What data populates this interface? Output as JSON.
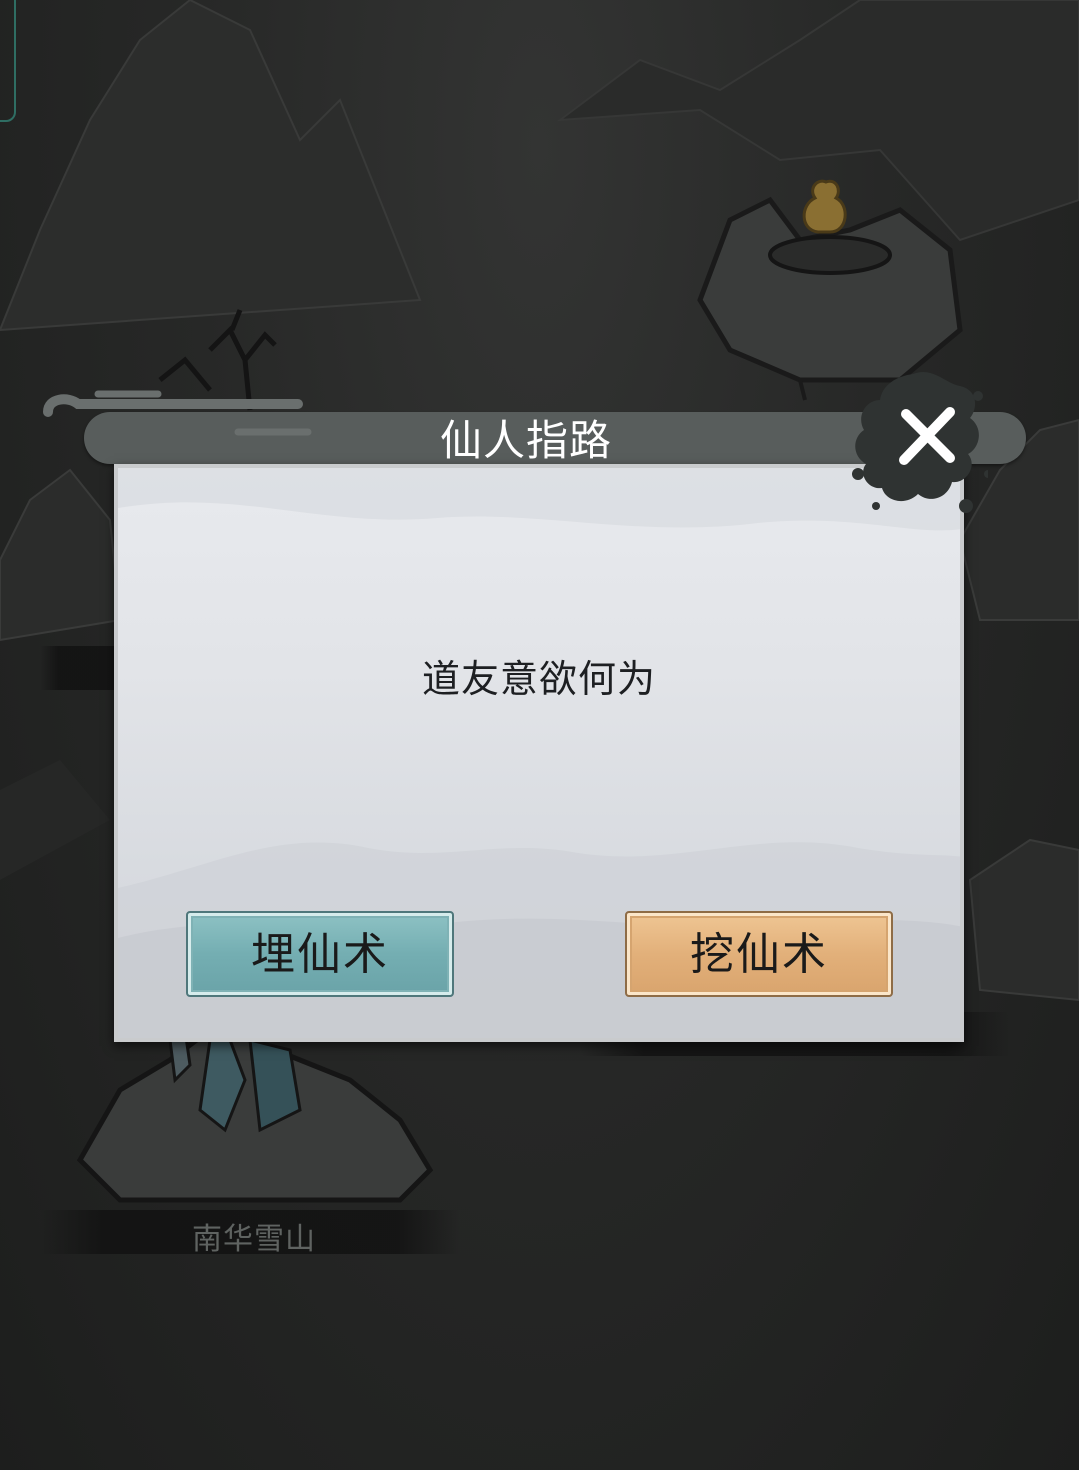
{
  "map": {
    "locations": [
      {
        "id": "nanhua",
        "label": "南华雪山"
      }
    ]
  },
  "dialog": {
    "title": "仙人指路",
    "message": "道友意欲何为",
    "buttons": {
      "bury": "埋仙术",
      "dig": "挖仙术"
    },
    "close_icon": "close-x-icon",
    "colors": {
      "bury_button": "#7ab3b6",
      "dig_button": "#e3b37c",
      "title_bar": "#585d5c"
    }
  }
}
